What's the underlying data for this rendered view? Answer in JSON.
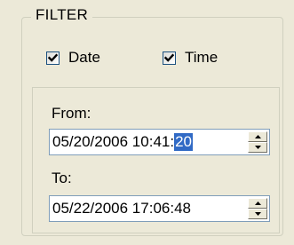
{
  "filter": {
    "title": "FILTER",
    "date_checkbox": {
      "label": "Date",
      "checked": true
    },
    "time_checkbox": {
      "label": "Time",
      "checked": true
    },
    "from": {
      "label": "From:",
      "value_prefix": "05/20/2006 10:41:",
      "value_selected": "20"
    },
    "to": {
      "label": "To:",
      "value": "05/22/2006 17:06:48"
    }
  },
  "icons": {
    "checkmark": "checkmark-icon",
    "spin_up": "up-arrow-icon",
    "spin_down": "down-arrow-icon"
  },
  "colors": {
    "background": "#ECE9D8",
    "field_border": "#7F9DB9",
    "selection": "#316AC5",
    "checkbox_border": "#1C5180",
    "group_border": "#D0D0BF"
  }
}
